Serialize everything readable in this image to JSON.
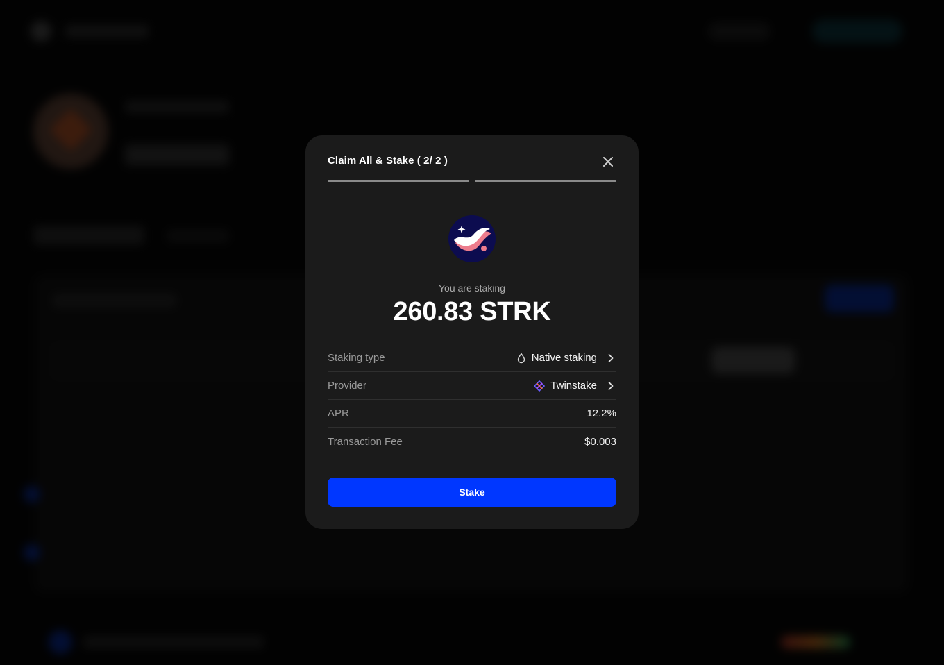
{
  "modal": {
    "title": "Claim All & Stake ( 2/ 2 )",
    "close_icon": "close-icon",
    "steps_total": 2,
    "steps_completed": 2
  },
  "token": {
    "icon": "starknet-logo",
    "staking_label": "You are staking",
    "amount": "260.83 STRK"
  },
  "details": {
    "staking_type": {
      "label": "Staking type",
      "value": "Native staking",
      "icon": "droplet-icon"
    },
    "provider": {
      "label": "Provider",
      "value": "Twinstake",
      "icon": "twinstake-logo"
    },
    "apr": {
      "label": "APR",
      "value": "12.2%"
    },
    "fee": {
      "label": "Transaction Fee",
      "value": "$0.003"
    }
  },
  "actions": {
    "stake_label": "Stake"
  },
  "colors": {
    "accent": "#0037ff",
    "modal_bg": "#1b1b1b",
    "token_bg": "#0c0c4f"
  }
}
